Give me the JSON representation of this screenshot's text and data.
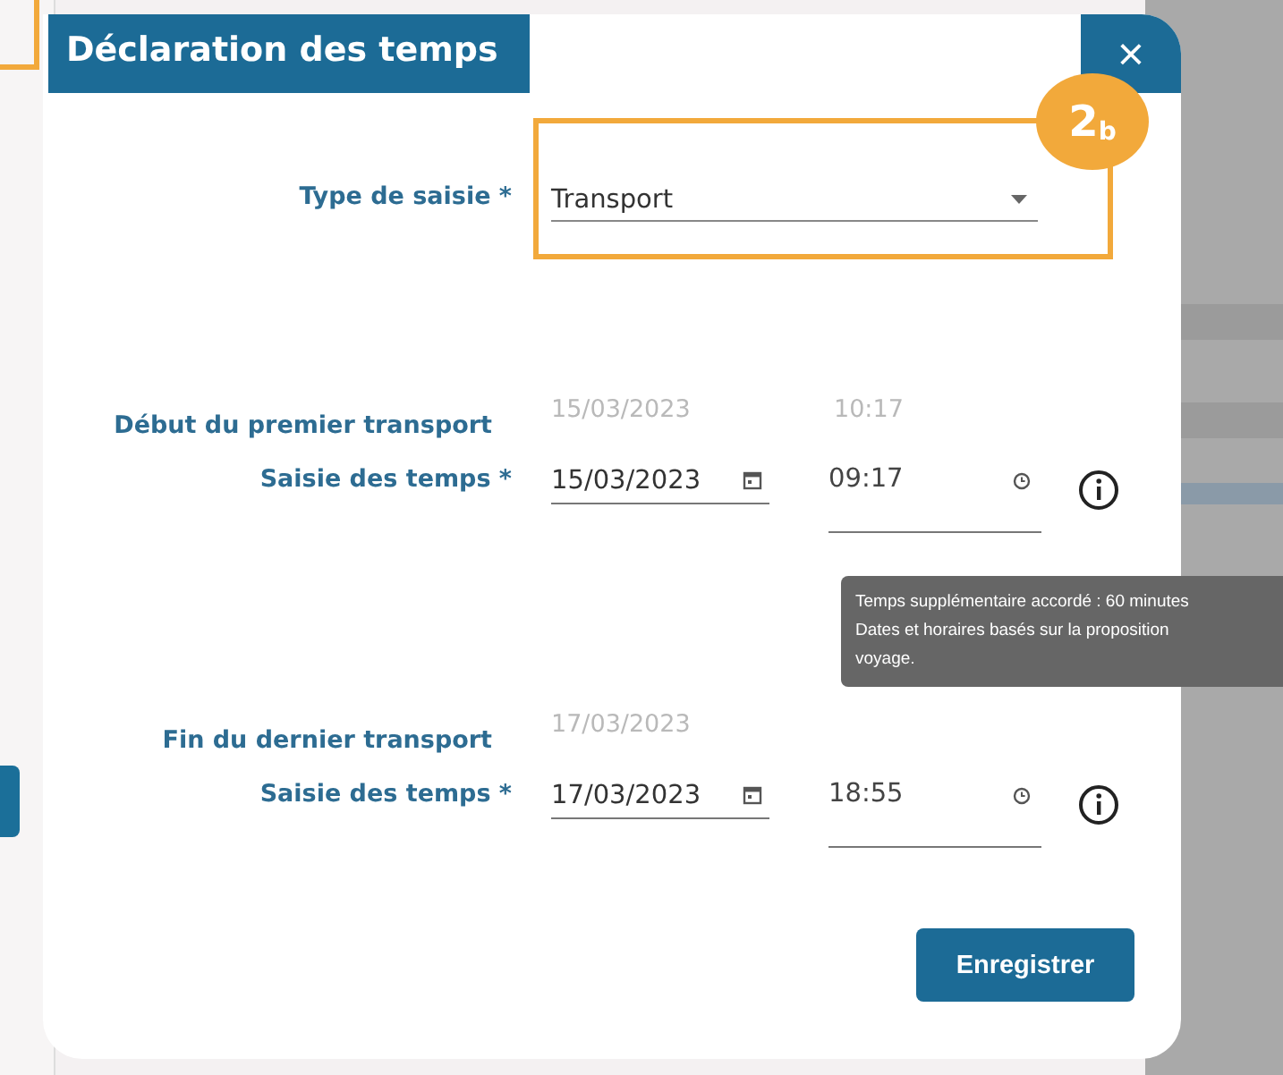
{
  "dialog": {
    "title": "Déclaration des temps",
    "close": "×"
  },
  "annotation": {
    "badge": "2$_{b}$"
  },
  "fields": [
    {
      "kind": "select",
      "label": "Type de saisie *",
      "value": "Transport"
    },
    {
      "kind": "readonly",
      "label": "Début du premier transport",
      "date": "15/03/2023",
      "time": "10:17"
    },
    {
      "kind": "datetime",
      "label": "Saisie des temps *",
      "date": "15/03/2023",
      "time": "09:17"
    },
    {
      "kind": "readonly",
      "label": "Fin du dernier transport",
      "date": "17/03/2023"
    },
    {
      "kind": "datetime",
      "label": "Saisie des temps *",
      "date": "17/03/2023",
      "time": "18:55"
    }
  ],
  "tooltip": {
    "lines": [
      "Temps supplémentaire accordé : 60 minutes",
      "Dates et horaires basés sur la proposition",
      "voyage."
    ]
  },
  "save_button": "Enregistrer"
}
